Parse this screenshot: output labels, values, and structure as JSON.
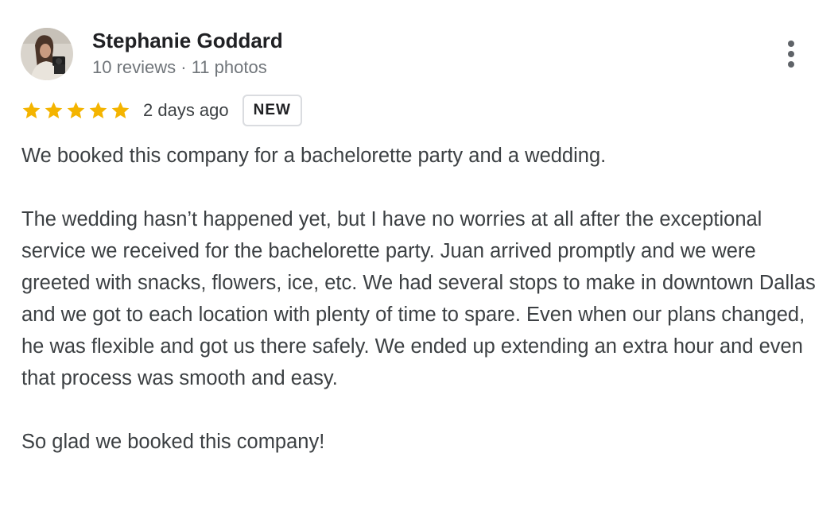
{
  "author": {
    "name": "Stephanie Goddard",
    "meta": "10 reviews · 11 photos"
  },
  "rating": {
    "stars": 5,
    "max": 5,
    "time_ago": "2 days ago",
    "badge": "NEW",
    "star_color": "#f4b400"
  },
  "review": {
    "paragraphs": [
      "We booked this company for a bachelorette party and a wedding.",
      "The wedding hasn’t happened yet, but I have no worries at all after the exceptional service we received for the bachelorette party. Juan arrived promptly and we were greeted with snacks, flowers, ice, etc. We had several stops to make in downtown Dallas and we got to each location with plenty of time to spare. Even when our plans changed, he was flexible and got us there safely. We ended up extending an extra hour and even that process was smooth and easy.",
      "So glad we booked this company!"
    ]
  },
  "icons": {
    "more": "more-vert-icon",
    "star": "star-icon"
  }
}
